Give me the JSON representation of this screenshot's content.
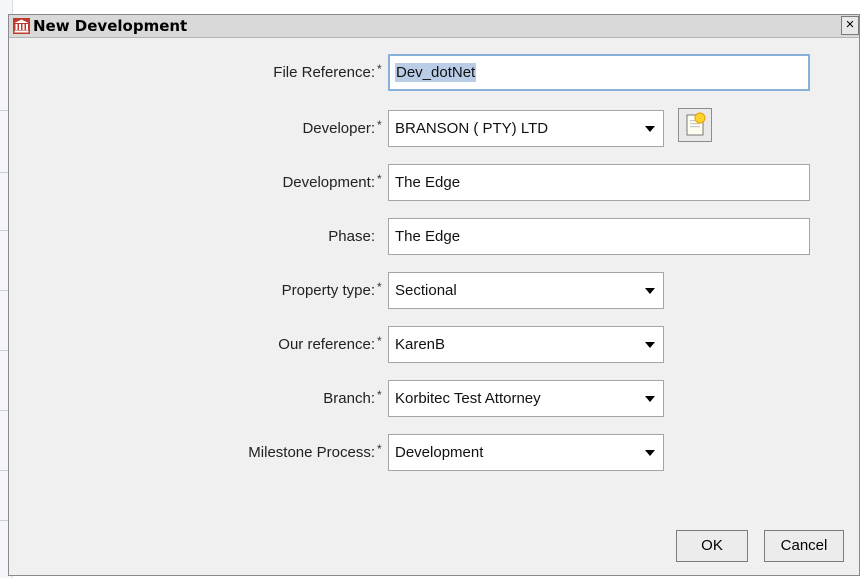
{
  "dialog": {
    "title": "New Development",
    "close": "×"
  },
  "form": {
    "file_reference": {
      "label": "File Reference:",
      "required": "*",
      "value": "Dev_dotNet"
    },
    "developer": {
      "label": "Developer:",
      "required": "*",
      "value": "BRANSON ( PTY) LTD"
    },
    "development": {
      "label": "Development:",
      "required": "*",
      "value": "The Edge"
    },
    "phase": {
      "label": "Phase:",
      "value": "The Edge"
    },
    "property_type": {
      "label": "Property type:",
      "required": "*",
      "value": "Sectional"
    },
    "our_reference": {
      "label": "Our reference:",
      "required": "*",
      "value": "KarenB"
    },
    "branch": {
      "label": "Branch:",
      "required": "*",
      "value": "Korbitec Test Attorney"
    },
    "milestone_process": {
      "label": "Milestone Process:",
      "required": "*",
      "value": "Development"
    }
  },
  "buttons": {
    "ok": "OK",
    "cancel": "Cancel"
  },
  "icons": {
    "app": "building-columns-icon",
    "new_developer": "new-document-icon",
    "dropdown": "chevron-down-icon"
  },
  "colors": {
    "accent_icon": "#c0392b",
    "focus_border": "#87b1d9",
    "selection": "#b9cde6"
  }
}
